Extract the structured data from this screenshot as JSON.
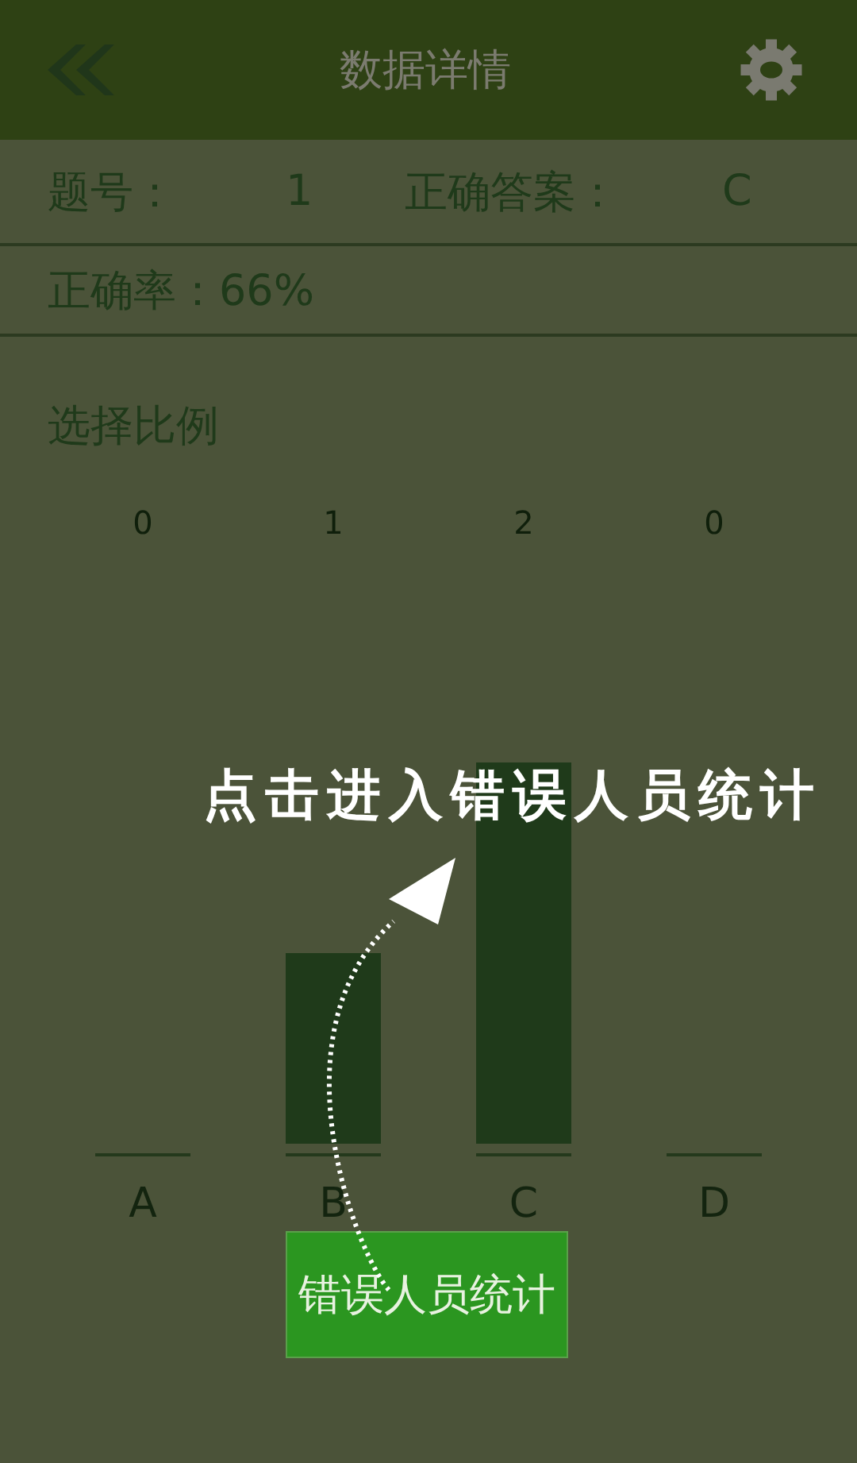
{
  "header": {
    "title": "数据详情"
  },
  "info": {
    "question_label": "题号：",
    "question_value": "1",
    "answer_label": "正确答案：",
    "answer_value": "C",
    "rate": "正确率：66%"
  },
  "section_title": "选择比例",
  "chart_data": {
    "type": "bar",
    "categories": [
      "A",
      "B",
      "C",
      "D"
    ],
    "values": [
      0,
      1,
      2,
      0
    ],
    "data_labels": true
  },
  "value_labels": [
    "0",
    "1",
    "2",
    "0"
  ],
  "hint": "点击进入错误人员统计",
  "button": "错误人员统计"
}
